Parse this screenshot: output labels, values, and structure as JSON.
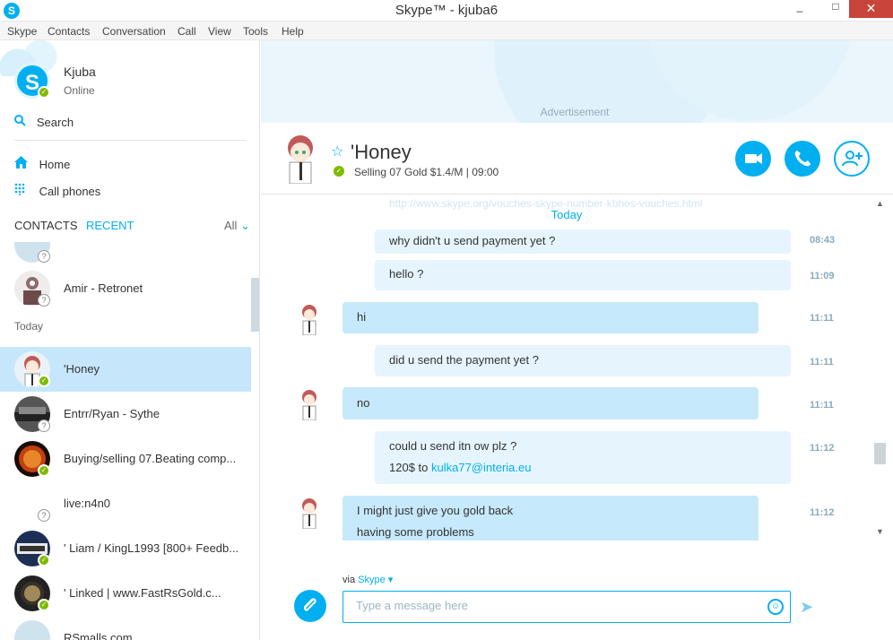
{
  "window": {
    "app_icon": "S",
    "title": "Skype™ - kjuba6",
    "min_glyph": "_",
    "max_glyph": "□",
    "close_glyph": "✕"
  },
  "menu": [
    "Skype",
    "Contacts",
    "Conversation",
    "Call",
    "View",
    "Tools",
    "Help"
  ],
  "profile": {
    "name": "Kjuba",
    "status": "Online",
    "avatar_glyph": "S"
  },
  "search_label": "Search",
  "nav": {
    "home": "Home",
    "call_phones": "Call phones"
  },
  "tabs": {
    "contacts": "CONTACTS",
    "recent": "RECENT",
    "filter": "All",
    "filter_caret": "⌄"
  },
  "status_glyphs": {
    "online": "✓",
    "unknown": "?"
  },
  "contacts": [
    {
      "name": "",
      "status": "unknown"
    },
    {
      "name": "Amir - Retronet",
      "status": "unknown"
    },
    {
      "name": "'Honey",
      "status": "online",
      "selected": true
    },
    {
      "name": "Entrr/Ryan - Sythe",
      "status": "unknown"
    },
    {
      "name": "Buying/selling 07.Beating comp...",
      "status": "online"
    },
    {
      "name": "live:n4n0",
      "status": "unknown"
    },
    {
      "name": "' Liam / KingL1993 [800+ Feedb...",
      "status": "online"
    },
    {
      "name": "'   Linked | www.FastRsGold.c...",
      "status": "online"
    },
    {
      "name": "RSmalls.com",
      "status": "unknown"
    }
  ],
  "section_today": "Today",
  "advertisement": "Advertisement",
  "chat": {
    "name": "'Honey",
    "mood": "Selling 07 Gold $1.4/M | 09:00",
    "star_glyph": "☆",
    "today": "Today",
    "ghost_text": "http://www.skype.org/vouches-skype-number-kbhos-vouches.html",
    "messages": [
      {
        "dir": "out",
        "lines": [
          "why didn't u send payment yet ?"
        ],
        "time": "08:43"
      },
      {
        "dir": "out",
        "lines": [
          "hello ?"
        ],
        "time": "11:09"
      },
      {
        "dir": "in",
        "lines": [
          "hi"
        ],
        "time": "11:11"
      },
      {
        "dir": "out",
        "lines": [
          "did u send the payment yet ?"
        ],
        "time": "11:11"
      },
      {
        "dir": "in",
        "lines": [
          "no"
        ],
        "time": "11:11"
      },
      {
        "dir": "out",
        "lines": [
          "could u send itn ow plz ?"
        ],
        "line2_prefix": "120$ to ",
        "link": "kulka77@interia.eu",
        "time": "11:12"
      },
      {
        "dir": "in",
        "lines": [
          "I might just give you gold back",
          "having some problems"
        ],
        "time": "11:12"
      }
    ]
  },
  "composer": {
    "via_prefix": "via ",
    "via_service": "Skype ▾",
    "placeholder": "Type a message here",
    "emoji_glyph": "☺",
    "send_glyph": "➤",
    "attach_glyph": "⌀"
  },
  "scroll": {
    "up": "▲",
    "down": "▼"
  },
  "colors": {
    "accent": "#00aff0",
    "online": "#7fba00",
    "selected_row": "#c6e7fb",
    "incoming_bubble": "#c6e9fb",
    "outgoing_bubble": "#e6f5fd"
  }
}
